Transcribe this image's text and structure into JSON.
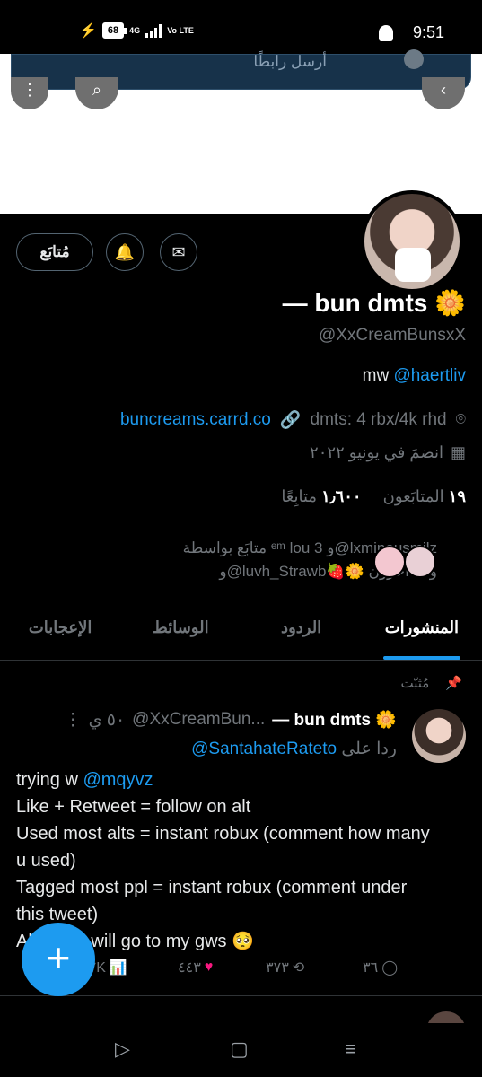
{
  "status_bar": {
    "battery": "68",
    "network": "4G",
    "volte": "Vo LTE",
    "time": "9:51"
  },
  "top_notice": {
    "text": "أرسل رابطًا"
  },
  "profile": {
    "follow_button": "مُتابَع",
    "display_name": "— bun dmts 🌼",
    "handle": "@XxCreamBunsxX",
    "bio_prefix": "mw ",
    "bio_mention": "@haertliv",
    "website": "buncreams.carrd.co",
    "location": "dmts: 4 rbx/4k rhd",
    "joined": "انضمَ في يونيو ٢٠٢٢",
    "following_count": "١٩",
    "following_label": "المتابَعون",
    "followers_count": "١٫٦٠٠",
    "followers_label": "متابِعًا",
    "followed_by_line1": "متابَع بواسطة ᵉᵐ lou 3 و@lxminousmilz",
    "followed_by_line2": "و@luvh_Strawb🍓🌼 و١٠ آخرون"
  },
  "tabs": [
    "المنشورات",
    "الردود",
    "الوسائط",
    "الإعجابات"
  ],
  "tweet": {
    "pinned_label": "مُثبّت",
    "author_name": "— bun dmts 🌼",
    "author_handle": "@XxCreamBun...",
    "time": "٥٠ ي",
    "reply_prefix": "ردا على",
    "reply_to": "@SantahateRateto",
    "line1_prefix": "trying w ",
    "line1_mention": "@mqyvz",
    "line2": "Like + Retweet = follow on alt",
    "line3": "Used most alts = instant robux (comment how many u used)",
    "line4": "Tagged most ppl = instant robux (comment under this tweet)",
    "line5": "All robux will go to my gws 🥺",
    "replies": "٣٦",
    "retweets": "٣٧٣",
    "likes": "٤٤٣",
    "views": "٦٧K"
  }
}
